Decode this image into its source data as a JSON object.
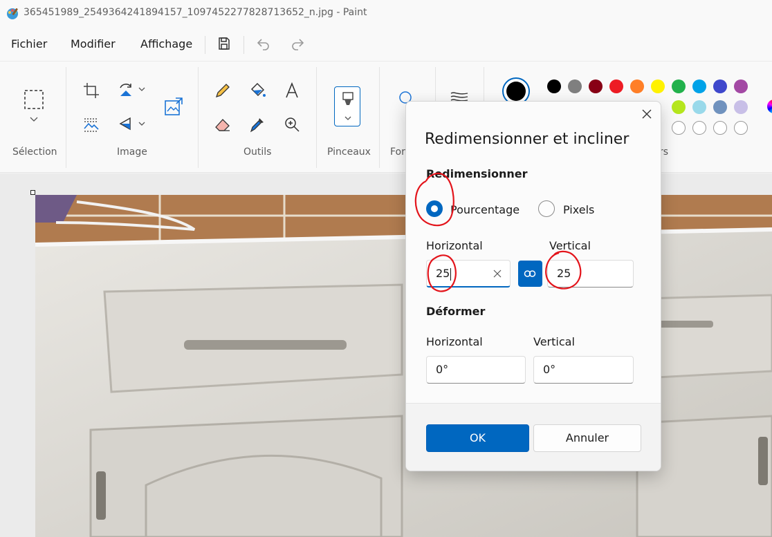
{
  "window": {
    "title": "365451989_2549364241894157_1097452277828713652_n.jpg - Paint"
  },
  "menu": {
    "items": [
      "Fichier",
      "Modifier",
      "Affichage"
    ],
    "icons": [
      "save-icon",
      "undo-icon",
      "redo-icon"
    ]
  },
  "ribbon": {
    "groups": {
      "selection": "Sélection",
      "image": "Image",
      "tools": "Outils",
      "brushes": "Pinceaux",
      "shapes": "For",
      "colors": "rs"
    },
    "palette": {
      "current_color": "#000000",
      "row1": [
        "#000000",
        "#7f7f7f",
        "#880015",
        "#ed1c24",
        "#ff7f27",
        "#fff200",
        "#22b14c",
        "#00a2e8",
        "#3f48cc",
        "#a349a4"
      ],
      "row2_visible": [
        "#b5e61d",
        "#99d9ea",
        "#7092be",
        "#c8bfe7"
      ],
      "row3_empty_count": 4
    }
  },
  "dialog": {
    "title": "Redimensionner et incliner",
    "resize": {
      "section": "Redimensionner",
      "option_percent": "Pourcentage",
      "option_pixels": "Pixels",
      "selected": "Pourcentage",
      "horizontal_label": "Horizontal",
      "vertical_label": "Vertical",
      "horizontal_value": "25",
      "vertical_value": "25",
      "aspect_locked": true
    },
    "skew": {
      "section": "Déformer",
      "horizontal_label": "Horizontal",
      "vertical_label": "Vertical",
      "horizontal_value": "0°",
      "vertical_value": "0°"
    },
    "ok_label": "OK",
    "cancel_label": "Annuler"
  },
  "colors": {
    "accent": "#0067c0",
    "annotation": "#e3141b"
  }
}
